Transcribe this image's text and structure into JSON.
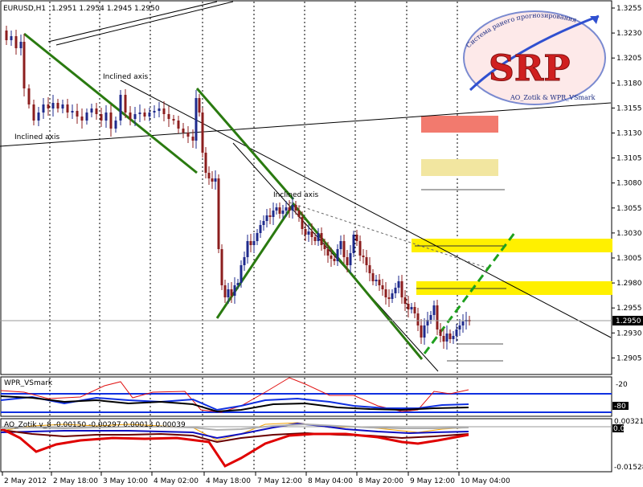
{
  "header": {
    "symbol": "EURUSD,H1",
    "ohlc": "1.2951 1.2954 1.2945 1.2950"
  },
  "annotations": {
    "inclined_axis_label": "Inclined axis"
  },
  "logo": {
    "text_main": "SRP",
    "text_arc": "Система ранего прогнозирования",
    "text_sub": "AO_Zotik & WPR_VSmark"
  },
  "price_axis": {
    "ticks": [
      "1.3255",
      "1.3230",
      "1.3205",
      "1.3180",
      "1.3155",
      "1.3130",
      "1.3105",
      "1.3080",
      "1.3055",
      "1.3030",
      "1.3005",
      "1.2980",
      "1.2955",
      "1.2930",
      "1.2905"
    ],
    "current_price": "1.2950"
  },
  "time_axis": {
    "labels": [
      "2 May 2012",
      "2 May 18:00",
      "3 May 10:00",
      "4 May 02:00",
      "4 May 18:00",
      "7 May 12:00",
      "8 May 04:00",
      "8 May 20:00",
      "9 May 12:00",
      "10 May 04:00"
    ]
  },
  "wpr_panel": {
    "title": "WPR_VSmark",
    "levels": [
      "-20",
      "-80"
    ]
  },
  "ao_panel": {
    "title": "AO_Zotik v_8 -0.00150 -0.00297 0.00013 0.00039",
    "levels": [
      "0.00321",
      "0.00",
      "-0.01528"
    ]
  },
  "colors": {
    "bull_candle": "#1e2a8c",
    "bear_candle": "#8c1e1e",
    "trend_green": "#2a7a10",
    "dash_green": "#1ea01e",
    "yellow_zone": "#fff000",
    "red_zone": "#f27a6e",
    "beige_zone": "#f2e6a0",
    "wpr_blue": "#1030e0",
    "wpr_red": "#e01010",
    "ao_red": "#e00000",
    "ao_dark": "#6a0000",
    "ao_blue": "#1010c0",
    "ao_orange": "#f0a000"
  },
  "chart_data": {
    "type": "candlestick",
    "series": [
      {
        "name": "EURUSD,H1",
        "close": [
          1.322,
          1.3205,
          1.3135,
          1.3125,
          1.3145,
          1.314,
          1.3135,
          1.3145,
          1.315,
          1.314,
          1.3145,
          1.315,
          1.3135,
          1.3175,
          1.314,
          1.312,
          1.309,
          1.3025,
          1.2965,
          1.3015,
          1.3045,
          1.306,
          1.305,
          1.3035,
          1.301,
          1.299,
          1.297,
          1.302,
          1.2985,
          1.2965,
          1.2955,
          1.292,
          1.2935,
          1.293,
          1.295
        ]
      }
    ],
    "ylim": [
      1.289,
      1.3265
    ]
  }
}
